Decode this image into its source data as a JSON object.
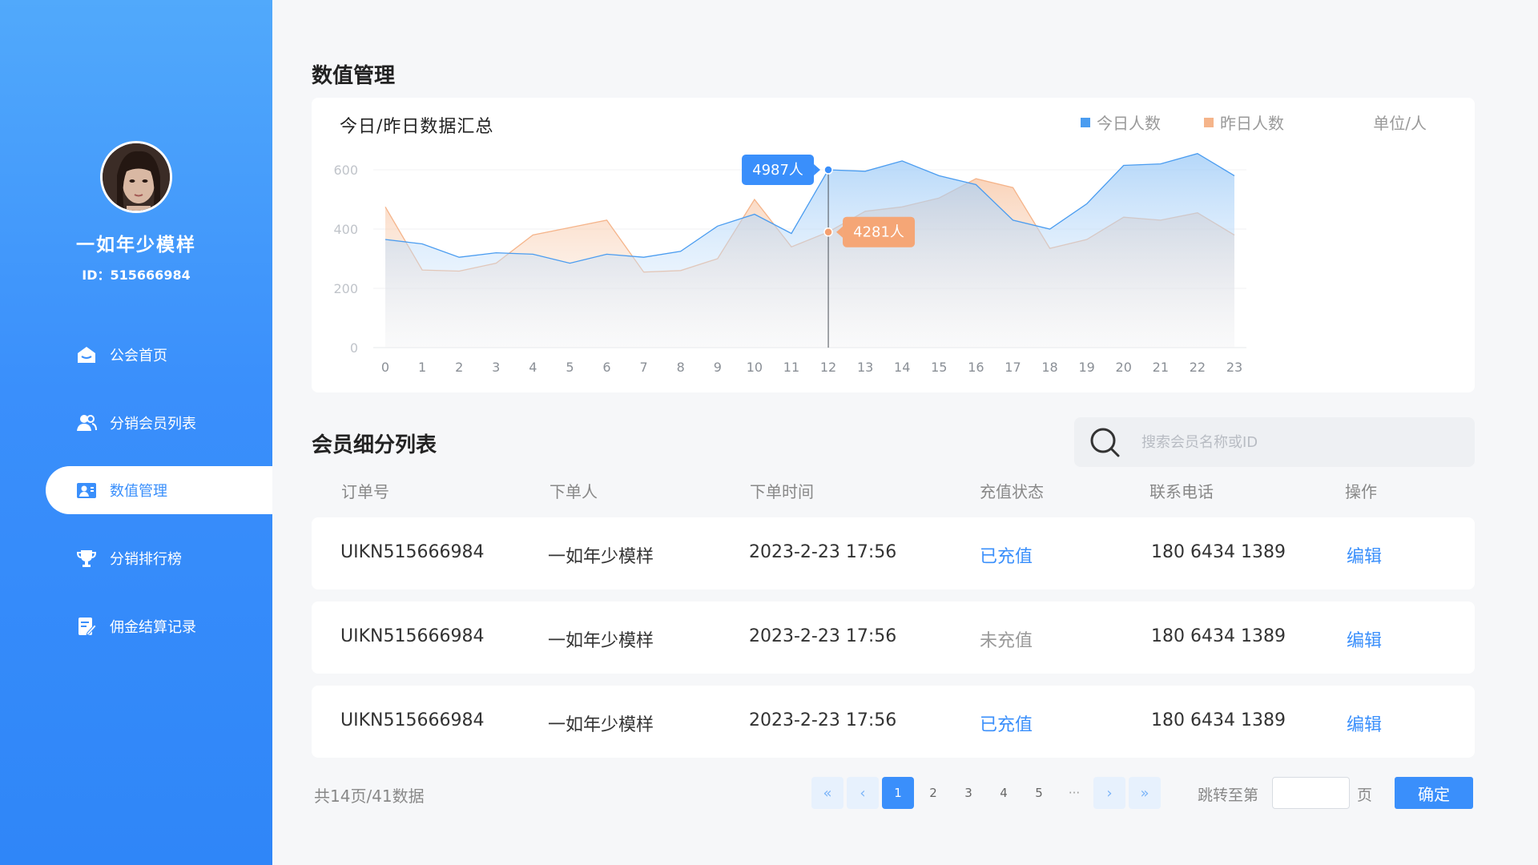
{
  "sidebar": {
    "user": {
      "name": "一如年少模样",
      "id_text": "ID：515666984"
    },
    "items": [
      {
        "label": "公会首页",
        "icon": "home-icon"
      },
      {
        "label": "分销会员列表",
        "icon": "users-icon"
      },
      {
        "label": "数值管理",
        "icon": "chart-user-icon",
        "active": true
      },
      {
        "label": "分销排行榜",
        "icon": "trophy-icon"
      },
      {
        "label": "佣金结算记录",
        "icon": "document-edit-icon"
      }
    ]
  },
  "main": {
    "page_title": "数值管理",
    "chart_card": {
      "title": "今日/昨日数据汇总",
      "legend_today": "今日人数",
      "legend_yesterday": "昨日人数",
      "unit": "单位/人",
      "tooltip_today": "4987人",
      "tooltip_yesterday": "4281人"
    },
    "list_title": "会员细分列表",
    "search": {
      "placeholder": "搜索会员名称或ID"
    },
    "table": {
      "headers": [
        "订单号",
        "下单人",
        "下单时间",
        "充值状态",
        "联系电话",
        "操作"
      ],
      "rows": [
        {
          "order": "UIKN515666984",
          "user": "一如年少模样",
          "time": "2023-2-23 17:56",
          "status": "已充值",
          "paid": true,
          "phone": "180 6434 1389",
          "action": "编辑"
        },
        {
          "order": "UIKN515666984",
          "user": "一如年少模样",
          "time": "2023-2-23 17:56",
          "status": "未充值",
          "paid": false,
          "phone": "180 6434 1389",
          "action": "编辑"
        },
        {
          "order": "UIKN515666984",
          "user": "一如年少模样",
          "time": "2023-2-23 17:56",
          "status": "已充值",
          "paid": true,
          "phone": "180 6434 1389",
          "action": "编辑"
        }
      ]
    },
    "pagination": {
      "total_text": "共14页/41数据",
      "pages": [
        "1",
        "2",
        "3",
        "4",
        "5",
        "···"
      ],
      "current": "1",
      "jump_label": "跳转至第",
      "page_word": "页",
      "confirm": "确定"
    }
  },
  "colors": {
    "accent": "#3a8ffb",
    "today": "#4a9cf0",
    "yesterday": "#f5b48a"
  },
  "chart_data": {
    "type": "area",
    "title": "今日/昨日数据汇总",
    "x": [
      0,
      1,
      2,
      3,
      4,
      5,
      6,
      7,
      8,
      9,
      10,
      11,
      12,
      13,
      14,
      15,
      16,
      17,
      18,
      19,
      20,
      21,
      22,
      23
    ],
    "ylim": [
      0,
      600
    ],
    "yticks": [
      0,
      200,
      400,
      600
    ],
    "grid": true,
    "legend_position": "top-right",
    "series": [
      {
        "name": "今日人数",
        "color": "#4a9cf0",
        "values": [
          365,
          350,
          305,
          320,
          315,
          285,
          315,
          305,
          325,
          410,
          450,
          385,
          600,
          595,
          630,
          580,
          550,
          430,
          400,
          485,
          615,
          620,
          655,
          580
        ]
      },
      {
        "name": "昨日人数",
        "color": "#f5b48a",
        "values": [
          475,
          262,
          258,
          285,
          380,
          405,
          430,
          255,
          260,
          300,
          500,
          340,
          390,
          460,
          475,
          505,
          570,
          540,
          335,
          365,
          440,
          430,
          455,
          380
        ]
      }
    ],
    "highlight": {
      "x": 12,
      "today_label": "4987人",
      "yesterday_label": "4281人"
    }
  }
}
